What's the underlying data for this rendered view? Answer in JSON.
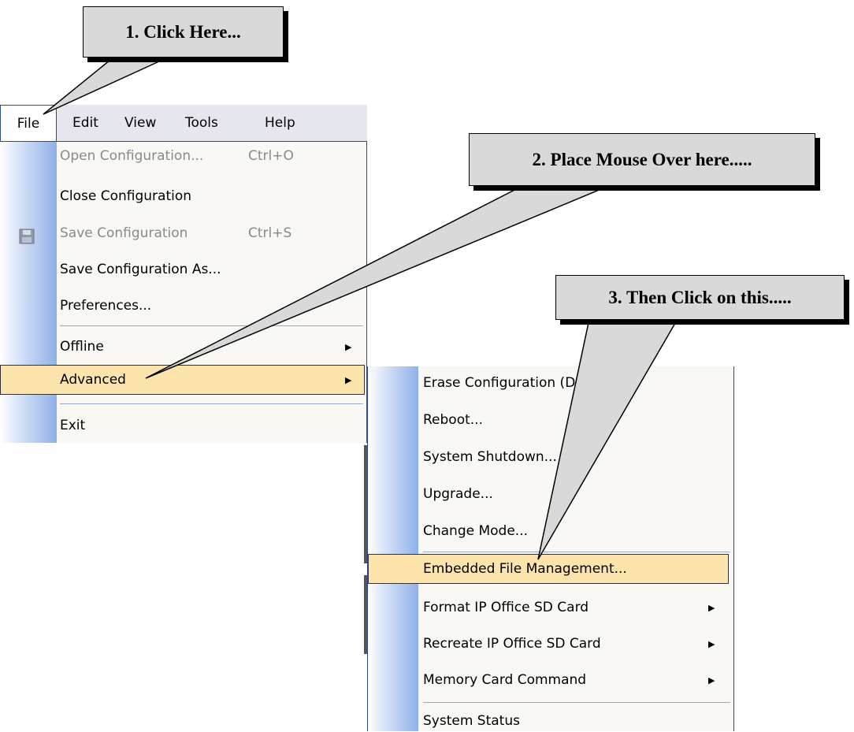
{
  "menubar": {
    "items": [
      "File",
      "Edit",
      "View",
      "Tools",
      "Help"
    ]
  },
  "file_menu": {
    "items": [
      {
        "label": "Open Configuration...",
        "shortcut": "Ctrl+O",
        "disabled": true
      },
      {
        "label": "Close Configuration",
        "shortcut": "",
        "disabled": false
      },
      {
        "label": "Save Configuration",
        "shortcut": "Ctrl+S",
        "disabled": true
      },
      {
        "label": "Save  Configuration As...",
        "shortcut": "",
        "disabled": false
      },
      {
        "label": "Preferences...",
        "shortcut": "",
        "disabled": false
      },
      {
        "label": "Offline",
        "submenu": true
      },
      {
        "label": "Advanced",
        "submenu": true,
        "highlighted": true
      },
      {
        "label": "Exit"
      }
    ]
  },
  "advanced_menu": {
    "items": [
      {
        "label": "Erase Configuration (D"
      },
      {
        "label": "Reboot..."
      },
      {
        "label": "System Shutdown..."
      },
      {
        "label": "Upgrade..."
      },
      {
        "label": "Change Mode..."
      },
      {
        "label": "Embedded File Management...",
        "highlighted": true
      },
      {
        "label": "Format IP Office SD Card",
        "submenu": true
      },
      {
        "label": "Recreate IP Office SD Card",
        "submenu": true
      },
      {
        "label": "Memory Card Command",
        "submenu": true
      },
      {
        "label": "System Status"
      }
    ]
  },
  "callouts": {
    "step1": "1. Click Here...",
    "step2": "2. Place Mouse Over here.....",
    "step3": "3. Then Click on this....."
  },
  "icons": {
    "save": "floppy-disk-icon",
    "submenu": "triangle-right-icon"
  },
  "colors": {
    "menubar": "#e6e6ef",
    "highlight": "#fde4ac",
    "menu_bg": "#f9f8f4",
    "callout": "#d9d9d9",
    "disabled_text": "#8a8a8a"
  }
}
